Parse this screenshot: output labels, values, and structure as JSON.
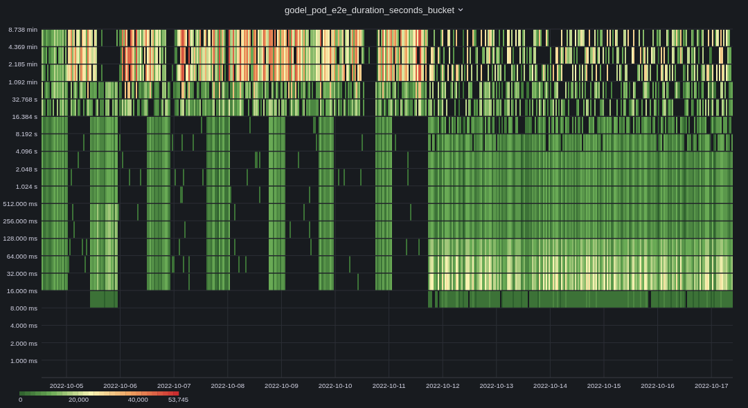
{
  "panel": {
    "title": "godel_pod_e2e_duration_seconds_bucket"
  },
  "y_axis": {
    "labels": [
      "8.738 min",
      "4.369 min",
      "2.185 min",
      "1.092 min",
      "32.768 s",
      "16.384 s",
      "8.192 s",
      "4.096 s",
      "2.048 s",
      "1.024 s",
      "512.000 ms",
      "256.000 ms",
      "128.000 ms",
      "64.000 ms",
      "32.000 ms",
      "16.000 ms",
      "8.000 ms",
      "4.000 ms",
      "2.000 ms",
      "1.000 ms"
    ]
  },
  "x_axis": {
    "labels": [
      "2022-10-05",
      "2022-10-06",
      "2022-10-07",
      "2022-10-08",
      "2022-10-09",
      "2022-10-10",
      "2022-10-11",
      "2022-10-12",
      "2022-10-13",
      "2022-10-14",
      "2022-10-15",
      "2022-10-16",
      "2022-10-17"
    ]
  },
  "legend": {
    "labels": [
      "0",
      "20,000",
      "40,000",
      "53,745"
    ]
  }
}
